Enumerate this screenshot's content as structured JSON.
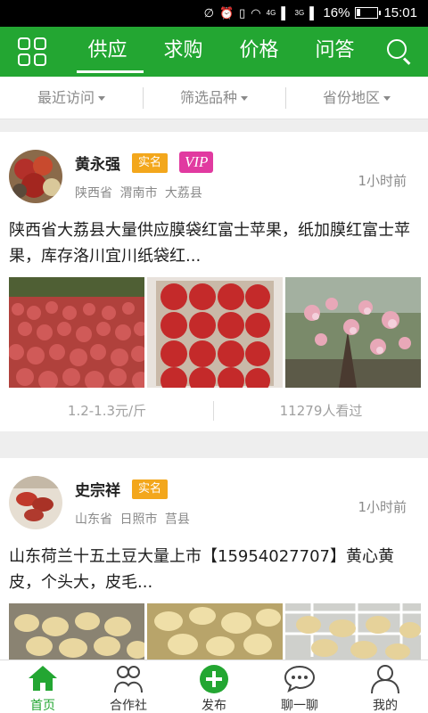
{
  "status_bar": {
    "network_4g": "4G",
    "network_3g": "3G",
    "battery": "16%",
    "time": "15:01"
  },
  "header": {
    "tabs": [
      {
        "label": "供应",
        "active": true
      },
      {
        "label": "求购",
        "active": false
      },
      {
        "label": "价格",
        "active": false
      },
      {
        "label": "问答",
        "active": false
      }
    ],
    "menu_icon": "grid-icon",
    "search_icon": "search-icon"
  },
  "filters": [
    {
      "label": "最近访问"
    },
    {
      "label": "筛选品种"
    },
    {
      "label": "省份地区"
    }
  ],
  "posts": [
    {
      "user": "黄永强",
      "verified_label": "实名",
      "vip_label": "VIP",
      "location": "陕西省 渭南市 大荔县",
      "time": "1小时前",
      "description": "陕西省大荔县大量供应膜袋红富士苹果，纸加膜红富士苹果，库存洛川宜川纸袋红...",
      "price": "1.2-1.3元/斤",
      "views": "11279人看过"
    },
    {
      "user": "史宗祥",
      "verified_label": "实名",
      "location": "山东省 日照市 莒县",
      "time": "1小时前",
      "description": "山东荷兰十五土豆大量上市【15954027707】黄心黄皮，个头大，皮毛..."
    }
  ],
  "bottom_nav": [
    {
      "label": "首页",
      "icon": "home-icon",
      "active": true
    },
    {
      "label": "合作社",
      "icon": "cooperative-icon",
      "active": false
    },
    {
      "label": "发布",
      "icon": "publish-plus-icon",
      "active": false
    },
    {
      "label": "聊一聊",
      "icon": "chat-icon",
      "active": false
    },
    {
      "label": "我的",
      "icon": "user-icon",
      "active": false
    }
  ],
  "colors": {
    "brand_green": "#23a632",
    "tag_orange": "#f3a71c",
    "vip_pink": "#e13aa0"
  }
}
